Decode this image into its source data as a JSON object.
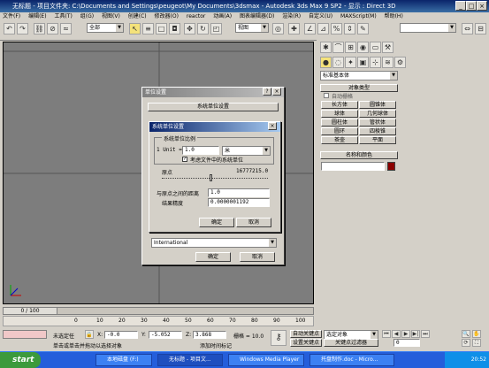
{
  "window": {
    "title": "无标题 - 项目文件夹: C:\\Documents and Settings\\peugeot\\My Documents\\3dsmax - Autodesk 3ds Max 9 SP2 - 显示 : Direct 3D"
  },
  "menubar": [
    "文件(F)",
    "编辑(E)",
    "工具(T)",
    "组(G)",
    "视图(V)",
    "创建(C)",
    "修改器(O)",
    "reactor",
    "动画(A)",
    "图表编辑器(D)",
    "渲染(R)",
    "自定义(U)",
    "MAXScript(M)",
    "帮助(H)"
  ],
  "toolbar": {
    "selection_filter": "全部",
    "ref_coord": "视图",
    "named_selection": ""
  },
  "command_panel": {
    "category": "标准基本体",
    "rollout_object_type": "对象类型",
    "autogrid_label": "自动栅格",
    "objects": [
      "长方体",
      "圆锥体",
      "球体",
      "几何球体",
      "圆柱体",
      "管状体",
      "圆环",
      "四棱锥",
      "茶壶",
      "平面"
    ],
    "rollout_name_color": "名称和颜色",
    "name_value": "",
    "object_color": "#8b0000"
  },
  "units_setup": {
    "title": "单位设置",
    "system_unit_button": "系统单位设置",
    "display_units_value": "International",
    "ok": "确定",
    "cancel": "取消"
  },
  "system_units": {
    "title": "系统单位设置",
    "group_label": "系统单位比例",
    "unit_prefix": "1 Unit =",
    "unit_value": "1.0",
    "unit_type": "米",
    "respect_files_label": "考虑文件中的系统单位",
    "respect_files_checked": true,
    "origin_label": "原点",
    "origin_value": "16777215.0",
    "distance_label": "与原点之间的距离",
    "distance_value": "1.0",
    "precision_label": "结果精度",
    "precision_value": "0.0000001192",
    "ok": "确定",
    "cancel": "取消"
  },
  "timeline": {
    "frame_counter": "0 / 100",
    "ticks": [
      "0",
      "10",
      "20",
      "30",
      "40",
      "50",
      "60",
      "70",
      "80",
      "90",
      "100"
    ]
  },
  "status": {
    "selection": "未选定任",
    "prompt": "单击或单击并拖动以选择对象",
    "add_time_tag": "添加时间标记",
    "x_label": "X:",
    "x_value": "-0.0",
    "y_label": "Y:",
    "y_value": "-5.052",
    "z_label": "Z:",
    "z_value": "3.868",
    "grid": "栅格 = 10.0",
    "auto_key": "自动关键点",
    "set_key": "设置关键点",
    "key_filter_combo": "选定对象",
    "key_filters": "关键点过滤器",
    "frame_value": "0"
  },
  "taskbar": {
    "start_label": "start",
    "tasks": [
      "本地磁盘 (F:)",
      "无标题 - 项目文...",
      "Windows Media Player",
      "托盘制作.doc - Micro..."
    ],
    "clock": "20:52"
  }
}
